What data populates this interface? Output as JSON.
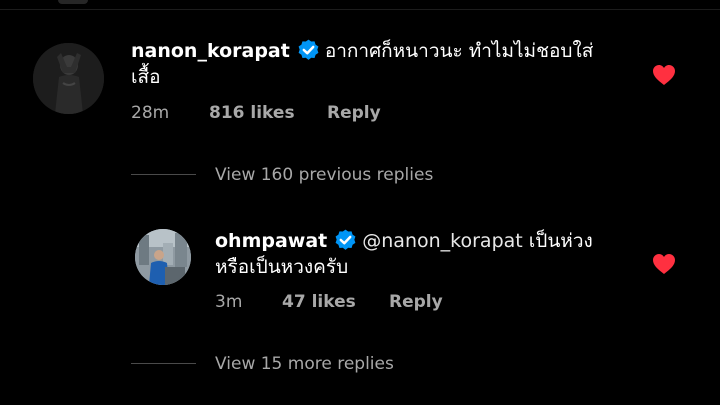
{
  "comments": [
    {
      "username": "nanon_korapat",
      "verified": true,
      "text": "อากาศก็หนาวนะ ทำไมไม่ชอบใส่เสื้อ",
      "time": "28m",
      "likes": "816 likes",
      "reply_label": "Reply",
      "liked": true
    },
    {
      "username": "ohmpawat",
      "verified": true,
      "mention": "@nanon_korapat",
      "text": "เป็นห่วงหรือเป็นหวงครับ",
      "time": "3m",
      "likes": "47 likes",
      "reply_label": "Reply",
      "liked": true
    }
  ],
  "view_previous_label": "View 160 previous replies",
  "view_more_label": "View 15 more replies",
  "colors": {
    "background": "#000000",
    "verified_blue": "#0095f6",
    "heart_red": "#ff3040",
    "muted_text": "#a8a8a8"
  },
  "icons": {
    "verified": "verified-badge-icon",
    "heart": "heart-filled-icon"
  }
}
